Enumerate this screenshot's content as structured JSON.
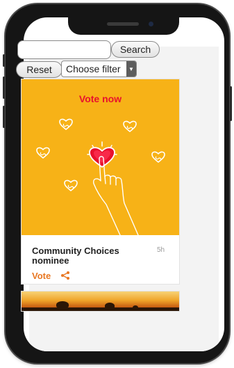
{
  "search": {
    "placeholder": "",
    "button_label": "Search"
  },
  "filter": {
    "reset_label": "Reset",
    "select_label": "Choose filter",
    "arrow_icon": "chevron-down-icon"
  },
  "card": {
    "image_heading": "Vote now",
    "title": "Community Choices nominee",
    "time": "5h",
    "vote_label": "Vote",
    "share_icon": "share-icon"
  },
  "colors": {
    "accent": "#e87722",
    "image_background": "#f7b217",
    "heading_red": "#e8112d"
  }
}
